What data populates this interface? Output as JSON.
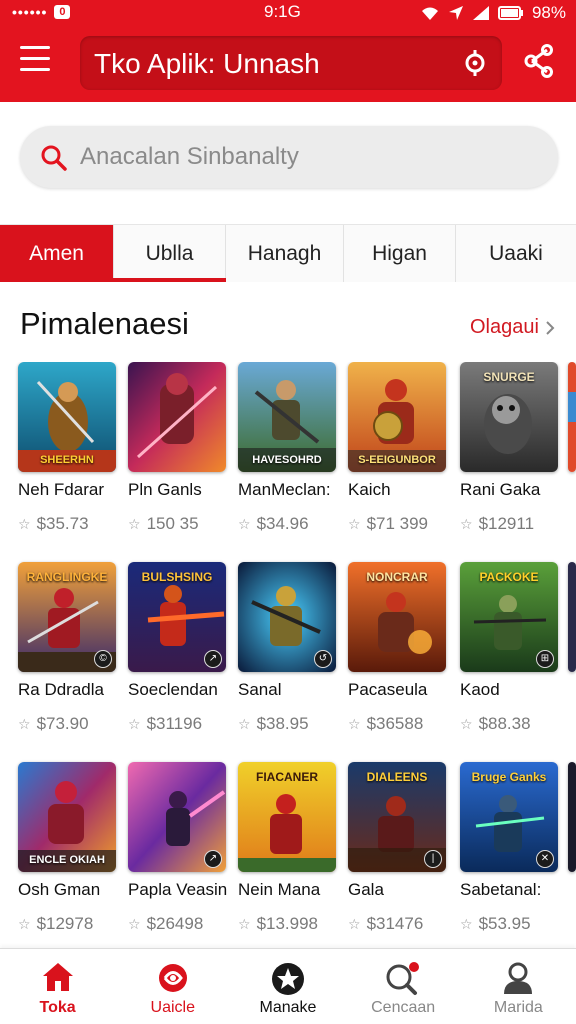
{
  "status_bar": {
    "signal_dots": "••••••",
    "notification_glyph": "0",
    "time": "9:1G",
    "battery": "98%"
  },
  "app_bar": {
    "title": "Tko Aplik: Unnash",
    "menu_icon": "hamburger-icon",
    "target_icon": "target-icon",
    "share_icon": "share-icon"
  },
  "search": {
    "placeholder": "Anacalan Sinbanalty"
  },
  "tabs": [
    {
      "label": "Amen",
      "active": true
    },
    {
      "label": "Ublla",
      "active": false
    },
    {
      "label": "Hanagh",
      "active": false
    },
    {
      "label": "Higan",
      "active": false
    },
    {
      "label": "Uaaki",
      "active": false
    }
  ],
  "section": {
    "title": "Pimalenaesi",
    "see_all": "Olagaui",
    "see_all_icon": "chevron-right-icon"
  },
  "games": [
    {
      "name": "Neh Fdarar",
      "price": "$35.73",
      "thumb_text": "SHEERHN",
      "badge": ""
    },
    {
      "name": "Pln Ganls",
      "price": "150 35",
      "thumb_text": "",
      "badge": ""
    },
    {
      "name": "ManMeclan:",
      "price": "$34.96",
      "thumb_text": "HAVESOHRD",
      "badge": ""
    },
    {
      "name": "Kaich",
      "price": "$71 399",
      "thumb_text": "S-EEIGUNBOR",
      "badge": ""
    },
    {
      "name": "Rani Gaka",
      "price": "$12911",
      "thumb_text": "SNURGE",
      "badge": ""
    },
    {
      "name": "Ra Ddradla",
      "price": "$73.90",
      "thumb_text": "RANGLINGKE",
      "badge": "©"
    },
    {
      "name": "Soeclendan",
      "price": "$31196",
      "thumb_text": "BULSHSING",
      "badge": "↗"
    },
    {
      "name": "Sanal",
      "price": "$38.95",
      "thumb_text": "",
      "badge": "↺"
    },
    {
      "name": "Pacaseula",
      "price": "$36588",
      "thumb_text": "NONCRAR",
      "badge": ""
    },
    {
      "name": "Kaod",
      "price": "$88.38",
      "thumb_text": "PACKOKE",
      "badge": "⊞"
    },
    {
      "name": "Osh Gman",
      "price": "$12978",
      "thumb_text": "ENCLE OKIAH",
      "badge": ""
    },
    {
      "name": "Papla Veasin",
      "price": "$26498",
      "thumb_text": "",
      "badge": "↗"
    },
    {
      "name": "Nein Mana",
      "price": "$13.998",
      "thumb_text": "FIACANER",
      "badge": ""
    },
    {
      "name": "Gala",
      "price": "$31476",
      "thumb_text": "DIALEENS",
      "badge": "|"
    },
    {
      "name": "Sabetanal:",
      "price": "$53.95",
      "thumb_text": "Bruge Ganks",
      "badge": "✕"
    }
  ],
  "bottom_nav": [
    {
      "label": "Toka",
      "icon": "home-icon",
      "active": true
    },
    {
      "label": "Uaicle",
      "icon": "swirl-icon",
      "active": false
    },
    {
      "label": "Manake",
      "icon": "star-badge-icon",
      "active": false
    },
    {
      "label": "Cencaan",
      "icon": "search-icon",
      "active": false
    },
    {
      "label": "Marida",
      "icon": "profile-icon",
      "active": false
    }
  ],
  "colors": {
    "brand_red": "#e3141f",
    "tab_active": "#d9121c",
    "see_all": "#d11a22"
  }
}
